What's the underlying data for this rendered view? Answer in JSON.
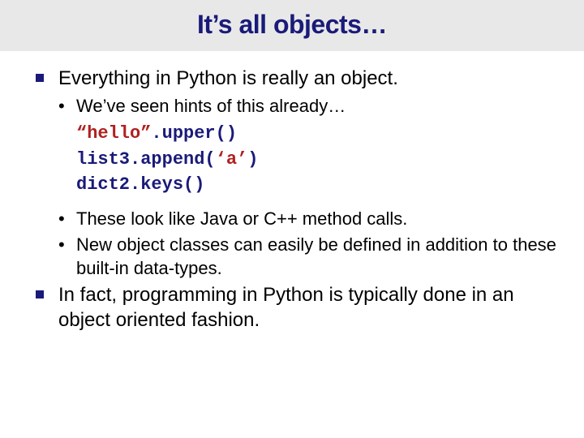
{
  "title": "It’s all objects…",
  "b1": "Everything in Python is really an object.",
  "s1": "We’ve seen hints of this already…",
  "c1a": "“hello”",
  "c1b": ".upper()",
  "c2a": "list3.append(",
  "c2b": "‘a’",
  "c2c": ")",
  "c3": "dict2.keys()",
  "s2": "These look like Java or C++ method calls.",
  "s3": "New object classes can easily be defined in addition to these built-in data-types.",
  "b2": "In fact, programming in Python is typically done in an object oriented fashion."
}
